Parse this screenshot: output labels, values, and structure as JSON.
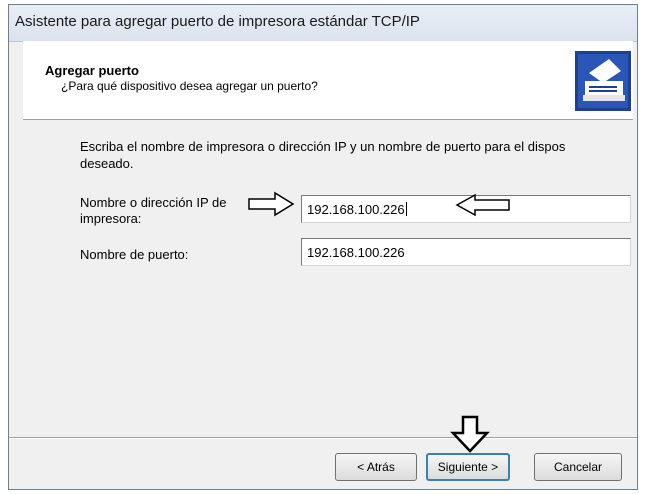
{
  "window": {
    "title": "Asistente para agregar puerto de impresora estándar TCP/IP"
  },
  "header": {
    "title": "Agregar puerto",
    "subtitle": "¿Para qué dispositivo desea agregar un puerto?",
    "icon": "printer-port-wizard-icon"
  },
  "main": {
    "description_line1": "Escriba el nombre de impresora o dirección IP y un nombre de puerto para el dispos",
    "description_line2": "deseado.",
    "printer_name_label_line1": "Nombre o dirección IP de",
    "printer_name_label_line2": "impresora:",
    "printer_name_value": "192.168.100.226",
    "port_name_label": "Nombre de puerto:",
    "port_name_value": "192.168.100.226"
  },
  "buttons": {
    "back": "< Atrás",
    "next": "Siguiente >",
    "cancel": "Cancelar"
  },
  "annotations": {
    "arrow_icons": [
      "arrow-right-icon",
      "arrow-left-icon",
      "arrow-down-icon"
    ]
  }
}
